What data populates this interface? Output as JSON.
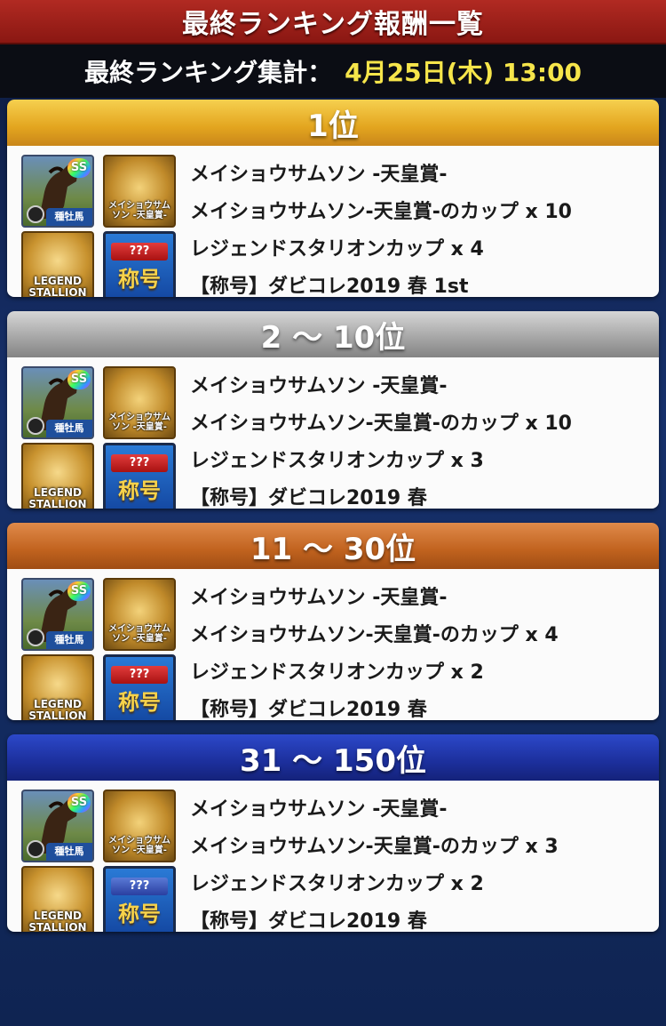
{
  "header": {
    "title": "最終ランキング報酬一覧"
  },
  "tally": {
    "label": "最終ランキング集計：",
    "value": "4月25日(木) 13:00"
  },
  "icons": {
    "horse_badge": "SS",
    "horse_tag": "種牡馬",
    "cup_label": "メイショウサムソン -天皇賞-",
    "legend_label": "LEGEND STALLION",
    "title_banner": "???",
    "title_label": "称号"
  },
  "tiers": [
    {
      "rank": "1位",
      "rewards": [
        "メイショウサムソン -天皇賞-",
        "メイショウサムソン-天皇賞-のカップ x 10",
        "レジェンドスタリオンカップ x 4",
        "【称号】ダビコレ2019 春 1st"
      ]
    },
    {
      "rank": "2 〜 10位",
      "rewards": [
        "メイショウサムソン -天皇賞-",
        "メイショウサムソン-天皇賞-のカップ x 10",
        "レジェンドスタリオンカップ x 3",
        "【称号】ダビコレ2019 春"
      ]
    },
    {
      "rank": "11 〜 30位",
      "rewards": [
        "メイショウサムソン -天皇賞-",
        "メイショウサムソン-天皇賞-のカップ x 4",
        "レジェンドスタリオンカップ x 2",
        "【称号】ダビコレ2019 春"
      ]
    },
    {
      "rank": "31 〜 150位",
      "rewards": [
        "メイショウサムソン -天皇賞-",
        "メイショウサムソン-天皇賞-のカップ x 3",
        "レジェンドスタリオンカップ x 2",
        "【称号】ダビコレ2019 春"
      ]
    }
  ]
}
